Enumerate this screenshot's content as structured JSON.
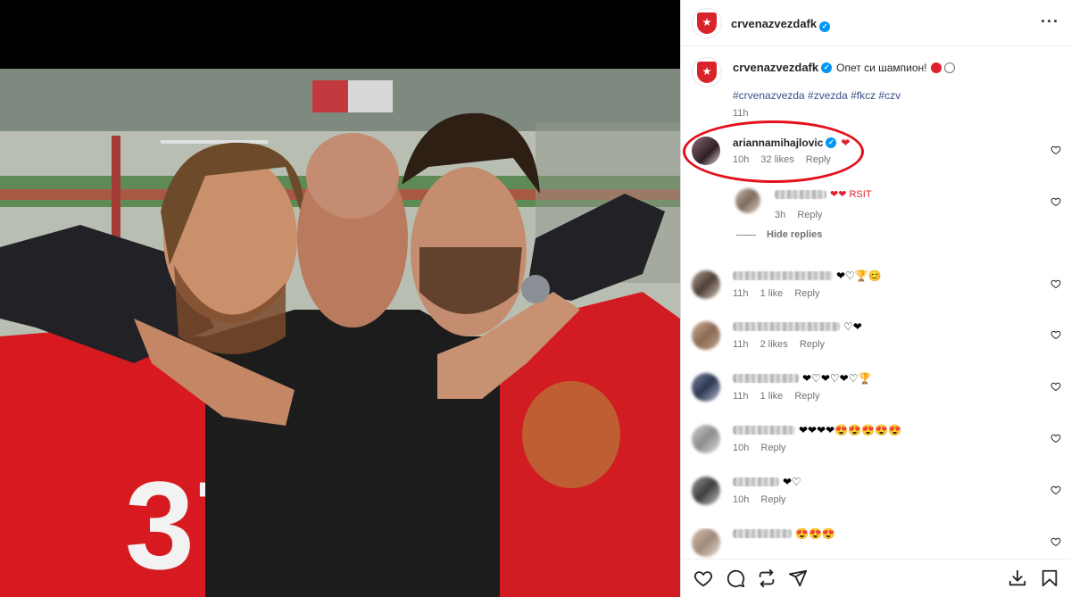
{
  "post": {
    "username": "crvenazvezdafk",
    "caption": "Опет си шампион!",
    "hashtags": "#crvenazvezda #zvezda #fkcz #czv",
    "time": "11h"
  },
  "comments": [
    {
      "user": "ariannamihajlovic",
      "verified": true,
      "text": "❤",
      "time": "10h",
      "likes": "32 likes",
      "reply": "Reply"
    },
    {
      "user": "",
      "text": "❤❤ RSIT",
      "time": "3h",
      "likes": "",
      "reply": "Reply",
      "nested": true
    },
    {
      "user": "",
      "text": "❤♡🏆😊",
      "time": "11h",
      "likes": "1 like",
      "reply": "Reply"
    },
    {
      "user": "",
      "text": "♡❤",
      "time": "11h",
      "likes": "2 likes",
      "reply": "Reply"
    },
    {
      "user": "",
      "text": "❤♡❤♡❤♡🏆",
      "time": "11h",
      "likes": "1 like",
      "reply": "Reply"
    },
    {
      "user": "",
      "text": "❤❤❤❤😍😍😍😍😍",
      "time": "10h",
      "likes": "",
      "reply": "Reply"
    },
    {
      "user": "",
      "text": "❤♡",
      "time": "10h",
      "likes": "",
      "reply": "Reply"
    },
    {
      "user": "",
      "text": "😍😍😍",
      "time": "",
      "likes": "",
      "reply": ""
    }
  ],
  "hide_replies": "Hide replies",
  "icons": {
    "more": "more-options-icon",
    "like": "heart-icon",
    "comment": "comment-icon",
    "share": "repost-icon",
    "send": "send-icon",
    "save": "bookmark-icon",
    "download": "download-icon"
  },
  "colors": {
    "verified": "#0095f6",
    "heart": "#e0202a",
    "highlight": "#e3111b"
  }
}
